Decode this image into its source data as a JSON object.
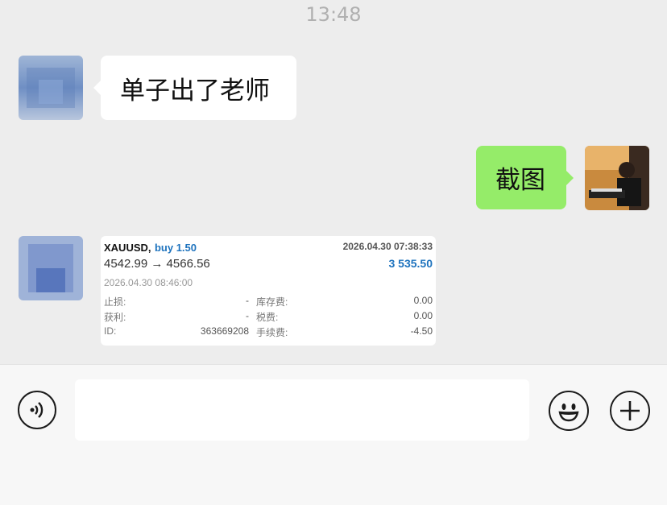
{
  "timestamp": "13:48",
  "messages": [
    {
      "side": "left",
      "text": "单子出了老师"
    },
    {
      "side": "right",
      "text": "截图"
    }
  ],
  "trade_card": {
    "symbol": "XAUUSD,",
    "side": "buy 1.50",
    "open_time": "2026.04.30 07:38:33",
    "prices": "4542.99 → 4566.56",
    "profit": "3 535.50",
    "close_time": "2026.04.30 08:46:00",
    "stop_loss_label": "止损:",
    "stop_loss_value": "-",
    "take_profit_label": "获利:",
    "take_profit_value": "-",
    "id_label": "ID:",
    "id_value": "363669208",
    "swap_label": "库存费:",
    "swap_value": "0.00",
    "tax_label": "税费:",
    "tax_value": "0.00",
    "commission_label": "手续费:",
    "commission_value": "-4.50"
  },
  "icons": {
    "voice": "voice-icon",
    "emoji": "emoji-icon",
    "plus": "plus-icon"
  },
  "input": {
    "value": ""
  }
}
